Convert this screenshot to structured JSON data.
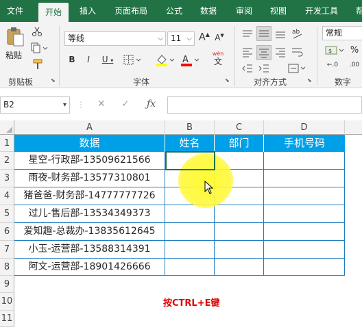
{
  "tabs": [
    {
      "label": "文件",
      "active": false
    },
    {
      "label": "开始",
      "active": true
    },
    {
      "label": "插入",
      "active": false
    },
    {
      "label": "页面布局",
      "active": false
    },
    {
      "label": "公式",
      "active": false
    },
    {
      "label": "数据",
      "active": false
    },
    {
      "label": "审阅",
      "active": false
    },
    {
      "label": "视图",
      "active": false
    },
    {
      "label": "开发工具",
      "active": false
    },
    {
      "label": "帮",
      "active": false
    }
  ],
  "ribbon": {
    "clipboard": {
      "paste_label": "粘贴",
      "group_label": "剪贴板"
    },
    "font": {
      "font_name": "等线",
      "font_size": "11",
      "wen_label": "wén",
      "wen_char": "文",
      "group_label": "字体"
    },
    "alignment": {
      "group_label": "对齐方式"
    },
    "number": {
      "format": "常规",
      "group_label": "数字"
    }
  },
  "formula_bar": {
    "name_box": "B2",
    "formula": ""
  },
  "columns": [
    "A",
    "B",
    "C",
    "D"
  ],
  "rows": [
    "1",
    "2",
    "3",
    "4",
    "5",
    "6",
    "7",
    "8",
    "9",
    "10",
    "11"
  ],
  "table": {
    "headers": [
      "数据",
      "姓名",
      "部门",
      "手机号码"
    ],
    "rows": [
      [
        "星空-行政部-13509621566",
        "",
        "",
        ""
      ],
      [
        "雨夜-财务部-13577310801",
        "",
        "",
        ""
      ],
      [
        "猪爸爸-财务部-14777777726",
        "",
        "",
        ""
      ],
      [
        "过儿-售后部-13534349373",
        "",
        "",
        ""
      ],
      [
        "爱知趣-总裁办-13835612645",
        "",
        "",
        ""
      ],
      [
        "小玉-运营部-13588314391",
        "",
        "",
        ""
      ],
      [
        "阿文-运营部-18901426666",
        "",
        "",
        ""
      ]
    ]
  },
  "hint": "按CTRL+E键",
  "colors": {
    "brand": "#217346",
    "header_fill": "#00a0e9",
    "border": "#1f7dc0",
    "hint": "#e00000",
    "highlight": "#fff830"
  }
}
